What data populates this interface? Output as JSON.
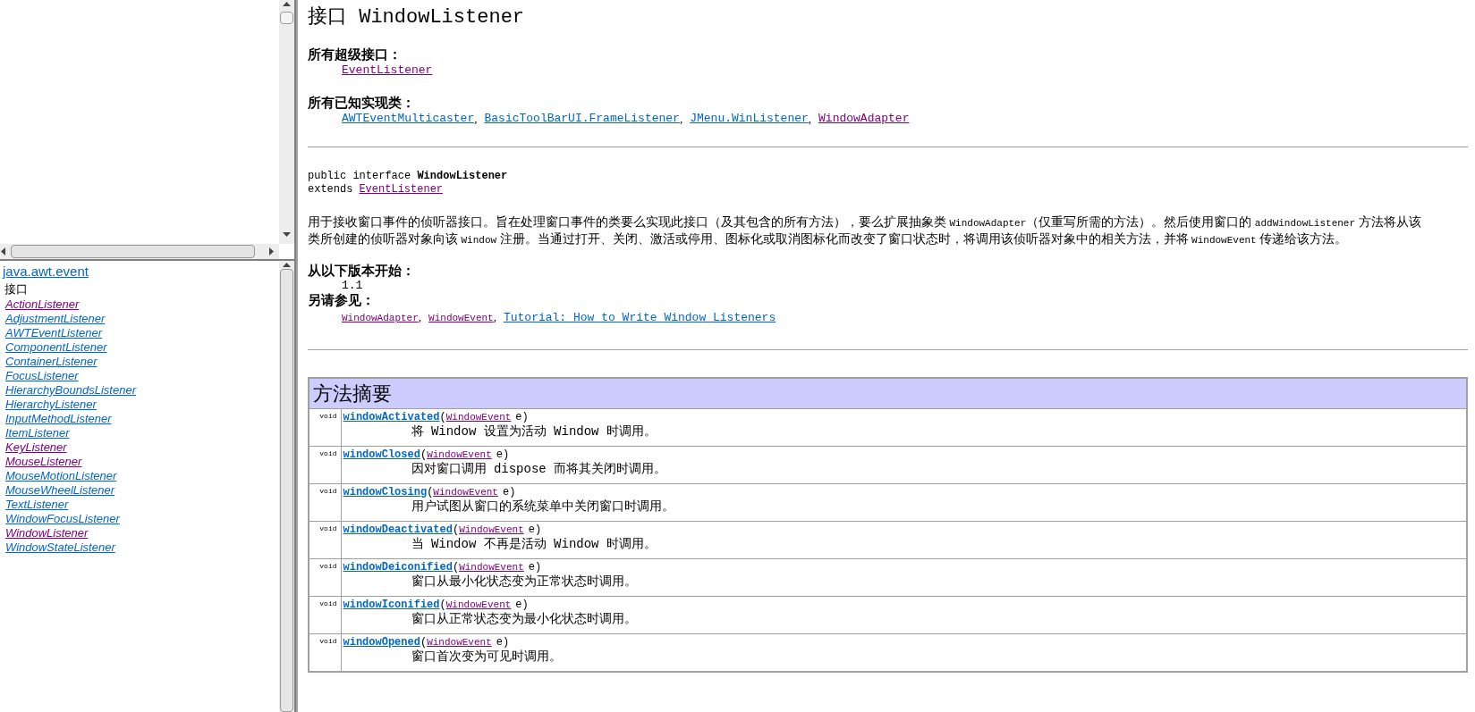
{
  "package_frame": {
    "package_link": "java.awt.event",
    "section_label": "接口",
    "interfaces": [
      {
        "name": "ActionListener",
        "visited": true
      },
      {
        "name": "AdjustmentListener",
        "visited": false
      },
      {
        "name": "AWTEventListener",
        "visited": false
      },
      {
        "name": "ComponentListener",
        "visited": false
      },
      {
        "name": "ContainerListener",
        "visited": false
      },
      {
        "name": "FocusListener",
        "visited": false
      },
      {
        "name": "HierarchyBoundsListener",
        "visited": false
      },
      {
        "name": "HierarchyListener",
        "visited": false
      },
      {
        "name": "InputMethodListener",
        "visited": false
      },
      {
        "name": "ItemListener",
        "visited": false
      },
      {
        "name": "KeyListener",
        "visited": true
      },
      {
        "name": "MouseListener",
        "visited": true
      },
      {
        "name": "MouseMotionListener",
        "visited": false
      },
      {
        "name": "MouseWheelListener",
        "visited": false
      },
      {
        "name": "TextListener",
        "visited": false
      },
      {
        "name": "WindowFocusListener",
        "visited": false
      },
      {
        "name": "WindowListener",
        "visited": true
      },
      {
        "name": "WindowStateListener",
        "visited": false
      }
    ]
  },
  "doc": {
    "title": "接口 WindowListener",
    "superinterfaces_label": "所有超级接口：",
    "superinterfaces": [
      {
        "name": "EventListener",
        "visited": true
      }
    ],
    "implementing_label": "所有已知实现类：",
    "implementing": [
      {
        "name": "AWTEventMulticaster",
        "visited": false,
        "separator": ","
      },
      {
        "name": "BasicToolBarUI.FrameListener",
        "visited": false,
        "separator": ","
      },
      {
        "name": "JMenu.WinListener",
        "visited": false,
        "separator": ","
      },
      {
        "name": "WindowAdapter",
        "visited": true
      }
    ],
    "declaration": "public interface **WindowListener**",
    "extends_label": "extends",
    "extends_link": {
      "name": "EventListener",
      "visited": true
    },
    "description": [
      {
        "kind": "text",
        "text": "用于接收窗口事件的侦听器接口。旨在处理窗口事件的类要么实现此接口（及其包含的所有方法），要么扩展抽象类 "
      },
      {
        "kind": "code",
        "text": "WindowAdapter"
      },
      {
        "kind": "text",
        "text": "（仅重写所需的方法）。然后使用窗口的 "
      },
      {
        "kind": "code",
        "text": "addWindowListener"
      },
      {
        "kind": "text",
        "text": " 方法将从该类所创建的侦听器对象向该 "
      },
      {
        "kind": "code",
        "text": "Window"
      },
      {
        "kind": "text",
        "text": " 注册。当通过打开、关闭、激活或停用、图标化或取消图标化而改变了窗口状态时，将调用该侦听器对象中的相关方法，并将 "
      },
      {
        "kind": "code",
        "text": "WindowEvent"
      },
      {
        "kind": "text",
        "text": " 传递给该方法。"
      }
    ],
    "since_label": "从以下版本开始：",
    "since": "1.1",
    "see_also_label": "另请参见：",
    "see_also": [
      {
        "name": "WindowAdapter",
        "visited": true,
        "kind": "code",
        "separator": ","
      },
      {
        "name": "WindowEvent",
        "visited": true,
        "kind": "code",
        "separator": ","
      },
      {
        "name": "Tutorial: How to Write Window Listeners",
        "visited": false,
        "kind": "tutorial"
      }
    ],
    "method_summary": {
      "title": "方法摘要",
      "rows": [
        {
          "type": "void",
          "name": "windowActivated",
          "open": "(",
          "param_type": "WindowEvent",
          "param": "e",
          "close": ")",
          "description": "将 Window 设置为活动 Window 时调用。"
        },
        {
          "type": "void",
          "name": "windowClosed",
          "open": "(",
          "param_type": "WindowEvent",
          "param": "e",
          "close": ")",
          "description": "因对窗口调用 dispose 而将其关闭时调用。"
        },
        {
          "type": "void",
          "name": "windowClosing",
          "open": "(",
          "param_type": "WindowEvent",
          "param": "e",
          "close": ")",
          "description": "用户试图从窗口的系统菜单中关闭窗口时调用。"
        },
        {
          "type": "void",
          "name": "windowDeactivated",
          "open": "(",
          "param_type": "WindowEvent",
          "param": "e",
          "close": ")",
          "description": "当 Window 不再是活动 Window 时调用。"
        },
        {
          "type": "void",
          "name": "windowDeiconified",
          "open": "(",
          "param_type": "WindowEvent",
          "param": "e",
          "close": ")",
          "description": "窗口从最小化状态变为正常状态时调用。"
        },
        {
          "type": "void",
          "name": "windowIconified",
          "open": "(",
          "param_type": "WindowEvent",
          "param": "e",
          "close": ")",
          "description": "窗口从正常状态变为最小化状态时调用。"
        },
        {
          "type": "void",
          "name": "windowOpened",
          "open": "(",
          "param_type": "WindowEvent",
          "param": "e",
          "close": ")",
          "description": "窗口首次变为可见时调用。"
        }
      ]
    }
  }
}
